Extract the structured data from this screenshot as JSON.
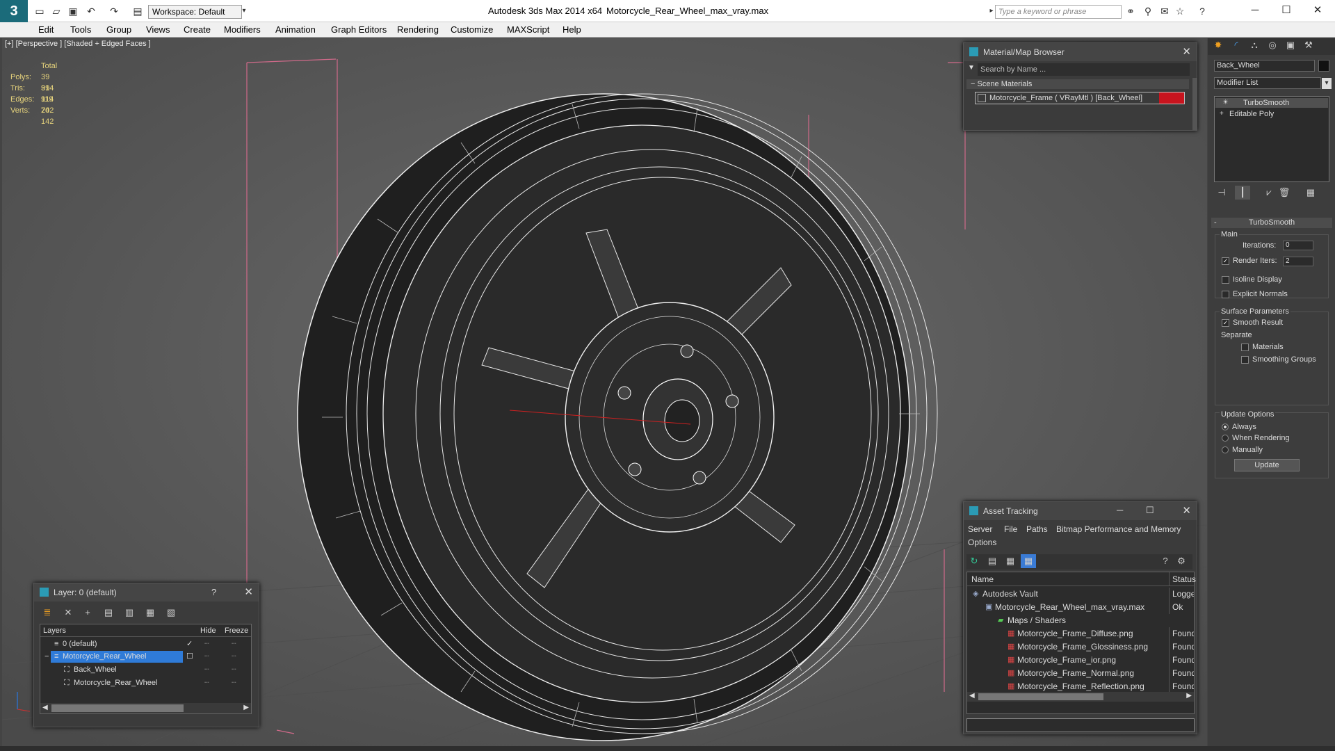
{
  "titlebar": {
    "app_title": "Autodesk 3ds Max  2014 x64",
    "file_title": "Motorcycle_Rear_Wheel_max_vray.max",
    "workspace": "Workspace: Default",
    "search_placeholder": "Type a keyword or phrase"
  },
  "menu": [
    "Edit",
    "Tools",
    "Group",
    "Views",
    "Create",
    "Modifiers",
    "Animation",
    "Graph Editors",
    "Rendering",
    "Customize",
    "MAXScript",
    "Help"
  ],
  "viewport": {
    "label": "[+] [Perspective ] [Shaded + Edged Faces ]",
    "stats": {
      "total_label": "Total",
      "polys_label": "Polys:",
      "polys": "39 914",
      "tris_label": "Tris:",
      "tris": "39 914",
      "edges_label": "Edges:",
      "edges": "119 742",
      "verts_label": "Verts:",
      "verts": "20 142"
    }
  },
  "material_browser": {
    "title": "Material/Map Browser",
    "search_placeholder": "Search by Name ...",
    "section": "Scene Materials",
    "item": "Motorcycle_Frame  ( VRayMtl )  [Back_Wheel]",
    "item_color": "#c8141e"
  },
  "command_panel": {
    "object_name": "Back_Wheel",
    "modifier_list": "Modifier List",
    "stack": [
      "TurboSmooth",
      "Editable Poly"
    ],
    "rollout_title": "TurboSmooth",
    "main_label": "Main",
    "iterations_label": "Iterations:",
    "iterations": "0",
    "render_iters_label": "Render Iters:",
    "render_iters": "2",
    "isoline_label": "Isoline Display",
    "explicit_normals_label": "Explicit Normals",
    "surface_params_label": "Surface Parameters",
    "smooth_result_label": "Smooth Result",
    "separate_label": "Separate",
    "materials_label": "Materials",
    "smoothing_groups_label": "Smoothing Groups",
    "update_options_label": "Update Options",
    "always_label": "Always",
    "when_rendering_label": "When Rendering",
    "manually_label": "Manually",
    "update_button": "Update"
  },
  "layer_panel": {
    "title": "Layer: 0 (default)",
    "help": "?",
    "col_layers": "Layers",
    "col_hide": "Hide",
    "col_freeze": "Freeze",
    "rows": [
      "0 (default)",
      "Motorcycle_Rear_Wheel",
      "Back_Wheel",
      "Motorcycle_Rear_Wheel"
    ]
  },
  "asset_tracking": {
    "title": "Asset Tracking",
    "menu": [
      "Server",
      "File",
      "Paths",
      "Bitmap Performance and Memory",
      "Options"
    ],
    "col_name": "Name",
    "col_status": "Status",
    "rows": [
      {
        "name": "Autodesk Vault",
        "status": "Logged"
      },
      {
        "name": "Motorcycle_Rear_Wheel_max_vray.max",
        "status": "Ok"
      },
      {
        "name": "Maps / Shaders",
        "status": ""
      },
      {
        "name": "Motorcycle_Frame_Diffuse.png",
        "status": "Found"
      },
      {
        "name": "Motorcycle_Frame_Glossiness.png",
        "status": "Found"
      },
      {
        "name": "Motorcycle_Frame_ior.png",
        "status": "Found"
      },
      {
        "name": "Motorcycle_Frame_Normal.png",
        "status": "Found"
      },
      {
        "name": "Motorcycle_Frame_Reflection.png",
        "status": "Found"
      }
    ]
  }
}
